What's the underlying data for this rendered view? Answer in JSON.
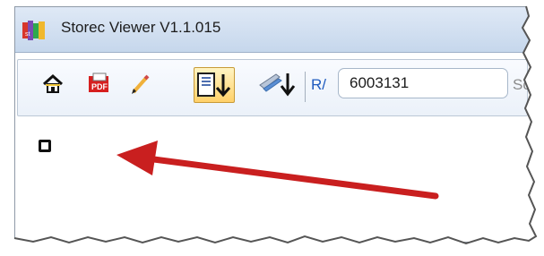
{
  "window": {
    "title": "Storec Viewer V1.1.015"
  },
  "toolbar": {
    "items": [
      {
        "name": "home-button",
        "icon": "home-icon"
      },
      {
        "name": "pdf-button",
        "icon": "pdf-icon",
        "label": "PDF"
      },
      {
        "name": "edit-button",
        "icon": "pencil-icon"
      },
      {
        "name": "download-record-button",
        "icon": "document-download-icon",
        "active": true
      },
      {
        "name": "scan-download-button",
        "icon": "scanner-download-icon"
      }
    ],
    "record_label": "R/",
    "record_value": "6003131",
    "partial_label": "Sc"
  },
  "content": {
    "indicator": "small-square-icon",
    "annotation": "red-arrow-icon",
    "annotation_color": "#c91f1f"
  },
  "colors": {
    "active_button": "#ffd16a",
    "titlebar": "#d7e4f4",
    "record_label": "#1f5bbf",
    "annotation": "#c91f1f"
  }
}
